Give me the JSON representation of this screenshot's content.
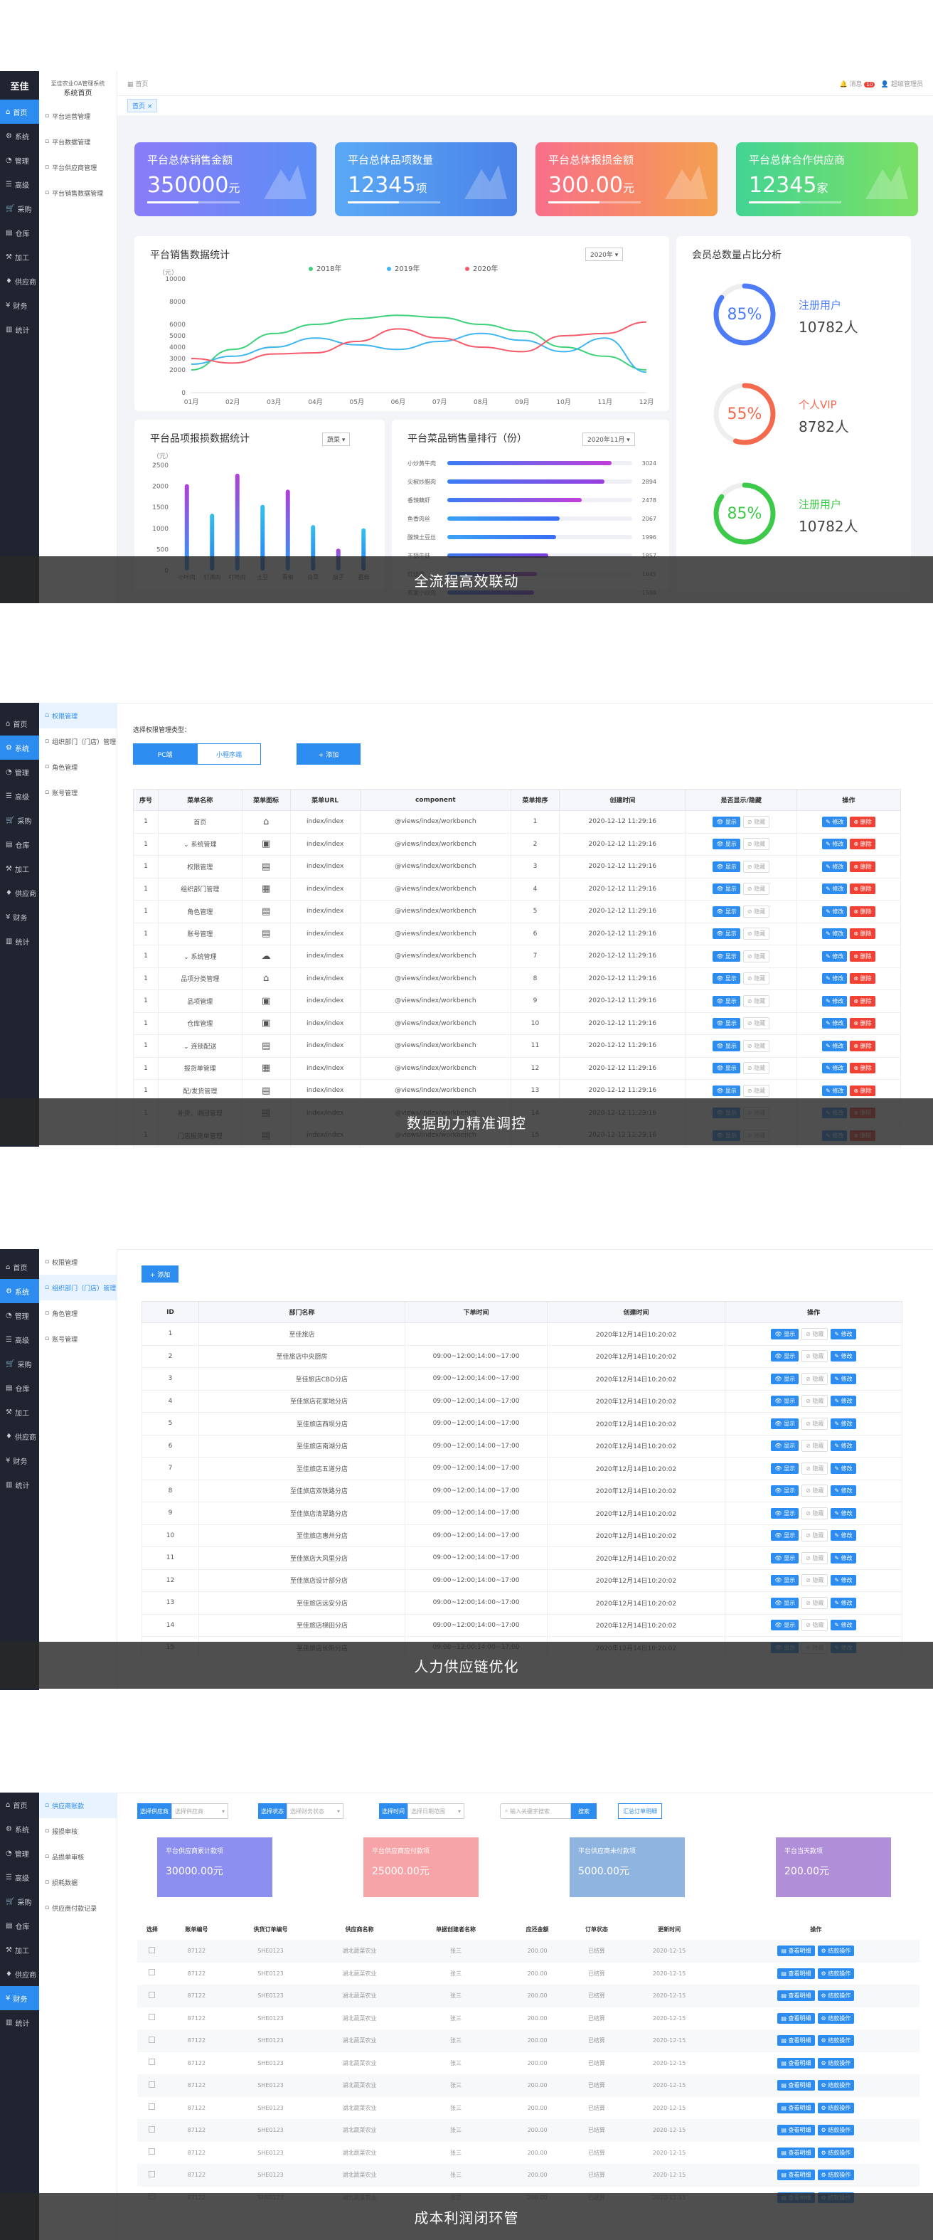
{
  "panel1": {
    "logo": "至佳",
    "sidebar": [
      "首页",
      "系统",
      "管理",
      "高级",
      "采购",
      "仓库",
      "加工",
      "供应商",
      "财务",
      "统计"
    ],
    "submenu_head": "至佳农业OA管理系统",
    "submenu_title": "系统首页",
    "submenu": [
      "平台运营管理",
      "平台数据管理",
      "平台供应商管理",
      "平台销售数据管理"
    ],
    "breadcrumb": "首页",
    "user": "超级管理员",
    "msg_label": "消息",
    "msg_count": "10",
    "tab": "首页",
    "stats": [
      {
        "title": "平台总体销售金额",
        "value": "350000",
        "unit": "元",
        "c1": "#8a7cf8",
        "c2": "#5b8ef6"
      },
      {
        "title": "平台总体品项数量",
        "value": "12345",
        "unit": "项",
        "c1": "#5aa9f5",
        "c2": "#4b82e8"
      },
      {
        "title": "平台总体报损金额",
        "value": "300.00",
        "unit": "元",
        "c1": "#f96f8a",
        "c2": "#f4a04f"
      },
      {
        "title": "平台总体合作供应商",
        "value": "12345",
        "unit": "家",
        "c1": "#43d494",
        "c2": "#7de063"
      }
    ],
    "sales": {
      "title": "平台销售数据统计",
      "year": "2020年",
      "legend": [
        "2018年",
        "2019年",
        "2020年"
      ],
      "ylabel": "（元）"
    },
    "loss": {
      "title": "平台品项报损数据统计",
      "sel": "蔬菜",
      "ylabel": "（元）"
    },
    "rank": {
      "title": "平台菜品销售量排行（份）",
      "sel": "2020年11月"
    },
    "member": {
      "title": "会员总数量占比分析",
      "items": [
        {
          "pct": "85%",
          "name": "注册用户",
          "count": "10782人",
          "color": "#4e7cf6",
          "frac": 0.85
        },
        {
          "pct": "55%",
          "name": "个人VIP",
          "count": "8782人",
          "color": "#f46a4f",
          "frac": 0.55
        },
        {
          "pct": "85%",
          "name": "注册用户",
          "count": "10782人",
          "color": "#3dc94a",
          "frac": 0.85
        }
      ]
    },
    "overlay": "全流程高效联动"
  },
  "chart_data": [
    {
      "type": "line",
      "title": "平台销售数据统计",
      "ylabel": "（元）",
      "ylim": [
        0,
        10000
      ],
      "yticks": [
        0,
        1000,
        2000,
        3000,
        4000,
        5000,
        6000,
        8000,
        10000
      ],
      "categories": [
        "01月",
        "02月",
        "03月",
        "04月",
        "05月",
        "06月",
        "07月",
        "08月",
        "09月",
        "10月",
        "11月",
        "12月"
      ],
      "series": [
        {
          "name": "2018年",
          "color": "#3dd17a",
          "values": [
            2000,
            3800,
            5200,
            6000,
            6500,
            6800,
            6600,
            6000,
            5400,
            4000,
            3200,
            2000
          ]
        },
        {
          "name": "2019年",
          "color": "#3fb6f2",
          "values": [
            2500,
            3200,
            4000,
            4800,
            4200,
            3800,
            4500,
            5200,
            4600,
            3600,
            4800,
            1800
          ]
        },
        {
          "name": "2020年",
          "color": "#f65a6b",
          "values": [
            3000,
            2600,
            3400,
            3500,
            4500,
            5600,
            4800,
            4000,
            3600,
            5000,
            5200,
            6200
          ]
        }
      ]
    },
    {
      "type": "bar",
      "title": "平台品项报损数据统计",
      "ylabel": "（元）",
      "ylim": [
        0,
        2500
      ],
      "yticks": [
        0,
        500,
        1000,
        1500,
        2000,
        2500
      ],
      "categories": [
        "小叶肉",
        "钉满肉",
        "叮咚肉",
        "土豆",
        "青椒",
        "白菜",
        "茄子",
        "番茄"
      ],
      "values": [
        2050,
        1350,
        2300,
        1560,
        1920,
        1080,
        520,
        1000
      ]
    },
    {
      "type": "bar",
      "title": "平台菜品销售量排行（份）",
      "categories": [
        "小炒黄牛肉",
        "尖椒炒腊肉",
        "香辣藕虾",
        "鱼香肉丝",
        "酸辣土豆丝",
        "干锅牛蛙",
        "红烧肉",
        "农家小炒肉"
      ],
      "values": [
        3024,
        2894,
        2478,
        2067,
        1996,
        1857,
        1645,
        1599
      ]
    }
  ],
  "panel2": {
    "sidebar": [
      "首页",
      "系统",
      "管理",
      "高级",
      "采购",
      "仓库",
      "加工",
      "供应商",
      "财务",
      "统计"
    ],
    "submenu": [
      "权限管理",
      "组织部门（门店）管理",
      "角色管理",
      "账号管理"
    ],
    "perm_label": "选择权限管理类型：",
    "seg": [
      "PC端",
      "小程序端"
    ],
    "add": "+ 添加",
    "headers": [
      "序号",
      "菜单名称",
      "菜单图标",
      "菜单URL",
      "component",
      "菜单排序",
      "创建时间",
      "是否显示/隐藏",
      "操作"
    ],
    "rows": [
      [
        "1",
        "首页",
        "index/index",
        "@views/index/workbench",
        "1"
      ],
      [
        "1",
        "系统管理",
        "index/index",
        "@views/index/workbench",
        "2"
      ],
      [
        "1",
        "权限管理",
        "index/index",
        "@views/index/workbench",
        "3"
      ],
      [
        "1",
        "组织部门管理",
        "index/index",
        "@views/index/workbench",
        "4"
      ],
      [
        "1",
        "角色管理",
        "index/index",
        "@views/index/workbench",
        "5"
      ],
      [
        "1",
        "账号管理",
        "index/index",
        "@views/index/workbench",
        "6"
      ],
      [
        "1",
        "系统管理",
        "index/index",
        "@views/index/workbench",
        "7"
      ],
      [
        "1",
        "品项分类管理",
        "index/index",
        "@views/index/workbench",
        "8"
      ],
      [
        "1",
        "品项管理",
        "index/index",
        "@views/index/workbench",
        "9"
      ],
      [
        "1",
        "仓库管理",
        "index/index",
        "@views/index/workbench",
        "10"
      ],
      [
        "1",
        "连锁配送",
        "index/index",
        "@views/index/workbench",
        "11"
      ],
      [
        "1",
        "报货单管理",
        "index/index",
        "@views/index/workbench",
        "12"
      ],
      [
        "1",
        "配/发货管理",
        "index/index",
        "@views/index/workbench",
        "13"
      ],
      [
        "1",
        "补货、退回管理",
        "index/index",
        "@views/index/workbench",
        "14"
      ],
      [
        "1",
        "门店报货单管理",
        "index/index",
        "@views/index/workbench",
        "15"
      ]
    ],
    "expand": [
      1,
      6,
      10
    ],
    "date": "2020-12-12 11:29:16",
    "show": "显示",
    "hide": "隐藏",
    "edit": "修改",
    "del": "删除",
    "overlay": "数据助力精准调控"
  },
  "panel3": {
    "submenu": [
      "权限管理",
      "组织部门（门店）管理",
      "角色管理",
      "账号管理"
    ],
    "add": "+ 添加",
    "headers": [
      "ID",
      "部门名称",
      "下单时间",
      "创建时间",
      "操作"
    ],
    "rows": [
      [
        "1",
        "至佳旅店",
        ""
      ],
      [
        "2",
        "至佳旅店中央厨房",
        "09:00~12:00;14:00~17:00"
      ],
      [
        "3",
        "至佳旅店CBD分店",
        "09:00~12:00;14:00~17:00"
      ],
      [
        "4",
        "至佳旅店花家地分店",
        "09:00~12:00;14:00~17:00"
      ],
      [
        "5",
        "至佳旅店西坝分店",
        "09:00~12:00;14:00~17:00"
      ],
      [
        "6",
        "至佳旅店南湖分店",
        "09:00~12:00;14:00~17:00"
      ],
      [
        "7",
        "至佳旅店五道分店",
        "09:00~12:00;14:00~17:00"
      ],
      [
        "8",
        "至佳旅店双铁路分店",
        "09:00~12:00;14:00~17:00"
      ],
      [
        "9",
        "至佳旅店清翠路分店",
        "09:00~12:00;14:00~17:00"
      ],
      [
        "10",
        "至佳旅店惠州分店",
        "09:00~12:00;14:00~17:00"
      ],
      [
        "11",
        "至佳旅店大风里分店",
        "09:00~12:00;14:00~17:00"
      ],
      [
        "12",
        "至佳旅店设计部分店",
        "09:00~12:00;14:00~17:00"
      ],
      [
        "13",
        "至佳旅店远安分店",
        "09:00~12:00;14:00~17:00"
      ],
      [
        "14",
        "至佳旅店梯田分店",
        "09:00~12:00;14:00~17:00"
      ],
      [
        "15",
        "至佳旅店长阳分店",
        "09:00~12:00;14:00~17:00"
      ]
    ],
    "date": "2020年12月14日10:20:02",
    "show": "显示",
    "hide": "隐藏",
    "edit": "修改",
    "overlay": "人力供应链优化"
  },
  "panel4": {
    "sidebar": [
      "首页",
      "系统",
      "管理",
      "高级",
      "采购",
      "仓库",
      "加工",
      "供应商",
      "财务",
      "统计"
    ],
    "submenu": [
      "供应商账款",
      "报损审核",
      "品损单审核",
      "损耗数据",
      "供应商付款记录"
    ],
    "filters": [
      {
        "label": "选择供应商",
        "ph": "选择供应商"
      },
      {
        "label": "选择状态",
        "ph": "选择财务状态"
      },
      {
        "label": "选择时间",
        "ph": "选择日期范围"
      }
    ],
    "search_ph": "输入关键字搜索",
    "search_btn": "搜索",
    "export": "汇总订单明细",
    "stats": [
      {
        "title": "平台供应商累计款项",
        "value": "30000.00元",
        "c": "#8c8ff0"
      },
      {
        "title": "平台供应商应付款项",
        "value": "25000.00元",
        "c": "#f7a4a8"
      },
      {
        "title": "平台供应商未付款项",
        "value": "5000.00元",
        "c": "#8fb4e0"
      },
      {
        "title": "平台当天款项",
        "value": "200.00元",
        "c": "#b08fd8"
      }
    ],
    "headers": [
      "选择",
      "账单编号",
      "供货订单编号",
      "供应商名称",
      "单据创建者名称",
      "应还金额",
      "订单状态",
      "更新时间",
      "操作"
    ],
    "row": [
      "87122",
      "SHE0123",
      "湖北蔬菜农业",
      "张三",
      "200.00",
      "已结算",
      "2020-12-15"
    ],
    "view": "查看明细",
    "flow": "结款操作",
    "overlay": "成本利润闭环管"
  }
}
